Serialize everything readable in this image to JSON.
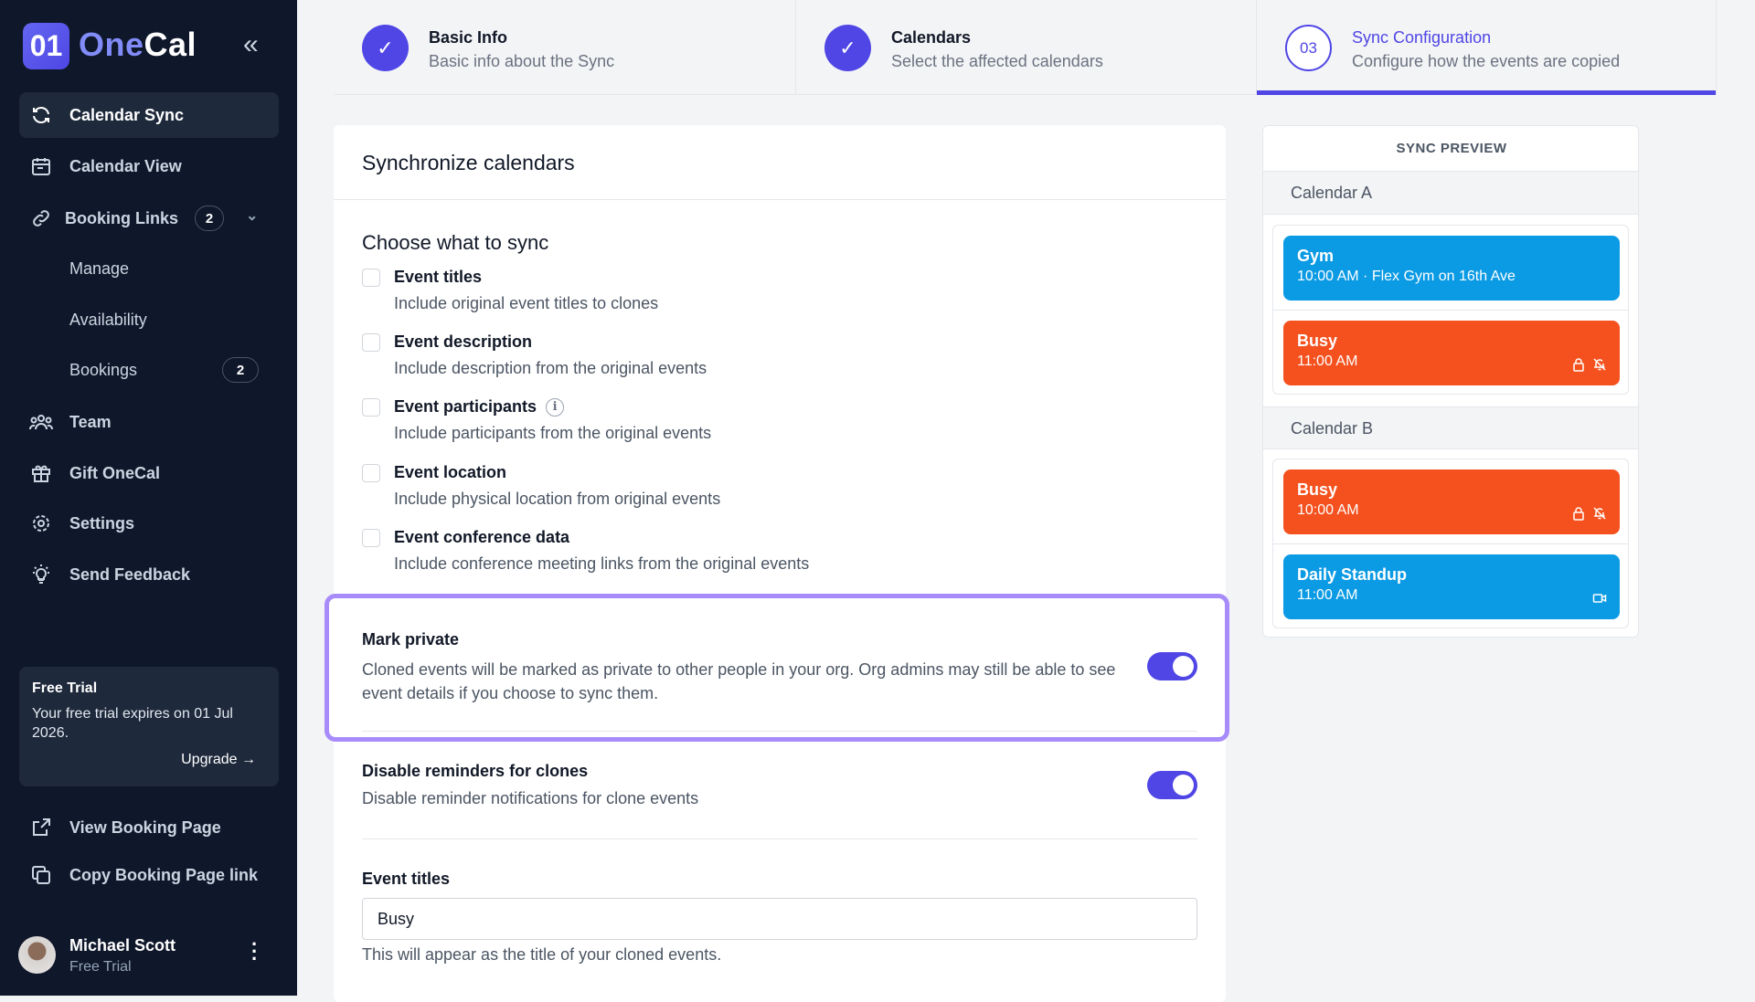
{
  "brand": {
    "logo_mark": "01",
    "name_part1": "One",
    "name_part2": "Cal"
  },
  "sidebar": {
    "items": [
      {
        "label": "Calendar Sync",
        "icon": "sync-icon",
        "active": true
      },
      {
        "label": "Calendar View",
        "icon": "calendar-icon"
      },
      {
        "label": "Booking Links",
        "icon": "link-icon",
        "badge": "2"
      },
      {
        "label": "Manage"
      },
      {
        "label": "Availability"
      },
      {
        "label": "Bookings",
        "badge": "2"
      },
      {
        "label": "Team",
        "icon": "team-icon"
      },
      {
        "label": "Gift OneCal",
        "icon": "gift-icon"
      },
      {
        "label": "Settings",
        "icon": "gear-icon"
      },
      {
        "label": "Send Feedback",
        "icon": "lightbulb-icon"
      }
    ],
    "trial": {
      "title": "Free Trial",
      "text": "Your free trial expires on 01 Jul 2026.",
      "upgrade": "Upgrade →"
    },
    "bottom": [
      {
        "label": "View Booking Page",
        "icon": "external-link-icon"
      },
      {
        "label": "Copy Booking Page link",
        "icon": "copy-icon"
      }
    ],
    "user": {
      "name": "Michael Scott",
      "plan": "Free Trial"
    }
  },
  "stepper": [
    {
      "title": "Basic Info",
      "desc": "Basic info about the Sync",
      "status": "done"
    },
    {
      "title": "Calendars",
      "desc": "Select the affected calendars",
      "status": "done"
    },
    {
      "number": "03",
      "title": "Sync Configuration",
      "desc": "Configure how the events are copied",
      "status": "active"
    }
  ],
  "card": {
    "title": "Synchronize calendars",
    "choose_title": "Choose what to sync",
    "options": [
      {
        "title": "Event titles",
        "desc": "Include original event titles to clones",
        "checked": false
      },
      {
        "title": "Event description",
        "desc": "Include description from the original events",
        "checked": false
      },
      {
        "title": "Event participants",
        "desc": "Include participants from the original events",
        "checked": false,
        "info": "i"
      },
      {
        "title": "Event location",
        "desc": "Include physical location from original events",
        "checked": false
      },
      {
        "title": "Event conference data",
        "desc": "Include conference meeting links from the original events",
        "checked": false
      }
    ],
    "mark_private": {
      "title": "Mark private",
      "desc": "Cloned events will be marked as private to other people in your org. Org admins may still be able to see event details if you choose to sync them.",
      "on": true
    },
    "disable_reminders": {
      "title": "Disable reminders for clones",
      "desc": "Disable reminder notifications for clone events",
      "on": true
    },
    "event_titles": {
      "label": "Event titles",
      "value": "Busy",
      "help": "This will appear as the title of your cloned events."
    }
  },
  "preview": {
    "title": "SYNC PREVIEW",
    "calendars": [
      {
        "name": "Calendar A",
        "events": [
          {
            "title": "Gym",
            "sub": "10:00 AM · Flex Gym on 16th Ave",
            "color": "#0b9ae4"
          },
          {
            "title": "Busy",
            "sub": "11:00 AM",
            "color": "#f4511e",
            "icons": [
              "lock-icon",
              "bell-off-icon"
            ]
          }
        ]
      },
      {
        "name": "Calendar B",
        "events": [
          {
            "title": "Busy",
            "sub": "10:00 AM",
            "color": "#f4511e",
            "icons": [
              "lock-icon",
              "bell-off-icon"
            ]
          },
          {
            "title": "Daily Standup",
            "sub": "11:00 AM",
            "color": "#0b9ae4",
            "icons": [
              "video-icon"
            ]
          }
        ]
      }
    ]
  },
  "colors": {
    "accent": "#4f46e5",
    "sidebar": "#0f172a",
    "highlight": "#a78bfa",
    "event_blue": "#0b9ae4",
    "event_orange": "#f4511e"
  }
}
